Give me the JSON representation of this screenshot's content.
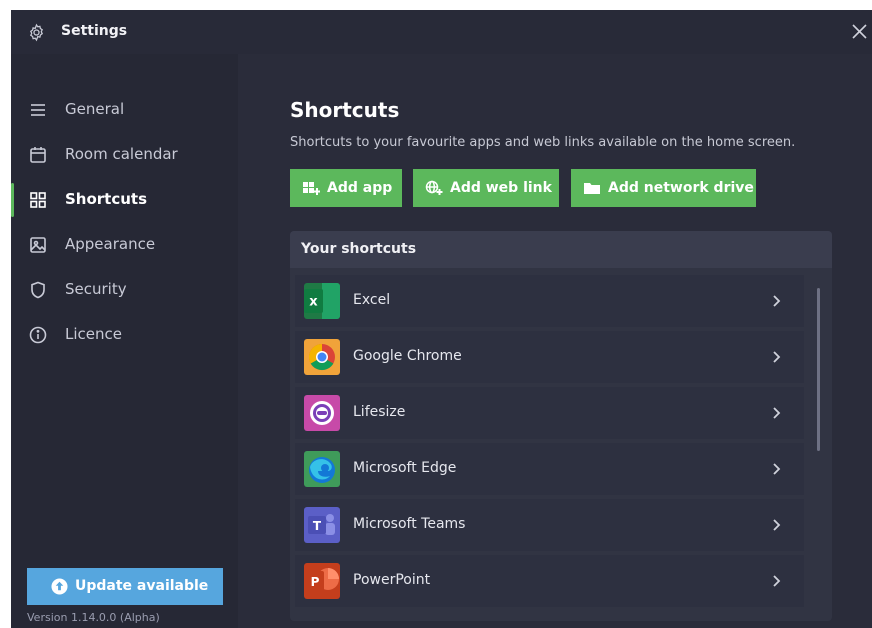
{
  "window": {
    "title": "Settings"
  },
  "sidebar": {
    "items": [
      {
        "label": "General",
        "icon": "menu-lines-icon"
      },
      {
        "label": "Room calendar",
        "icon": "calendar-icon"
      },
      {
        "label": "Shortcuts",
        "icon": "grid-icon",
        "active": true
      },
      {
        "label": "Appearance",
        "icon": "image-icon"
      },
      {
        "label": "Security",
        "icon": "shield-icon"
      },
      {
        "label": "Licence",
        "icon": "info-icon"
      }
    ],
    "update_label": "Update available",
    "version": "Version 1.14.0.0 (Alpha)"
  },
  "main": {
    "title": "Shortcuts",
    "description": "Shortcuts to your favourite apps and web links available on the home screen.",
    "buttons": {
      "add_app": "Add app",
      "add_web_link": "Add web link",
      "add_network_drive": "Add network drive"
    },
    "panel_title": "Your shortcuts",
    "shortcuts": [
      {
        "name": "Excel",
        "icon": "excel-icon"
      },
      {
        "name": "Google Chrome",
        "icon": "chrome-icon"
      },
      {
        "name": "Lifesize",
        "icon": "lifesize-icon"
      },
      {
        "name": "Microsoft Edge",
        "icon": "edge-icon"
      },
      {
        "name": "Microsoft Teams",
        "icon": "teams-icon"
      },
      {
        "name": "PowerPoint",
        "icon": "powerpoint-icon"
      }
    ]
  },
  "colors": {
    "accent_green": "#5cb85c",
    "update_blue": "#56a6de",
    "background": "#2a2c3a",
    "sidebar": "#262835"
  }
}
